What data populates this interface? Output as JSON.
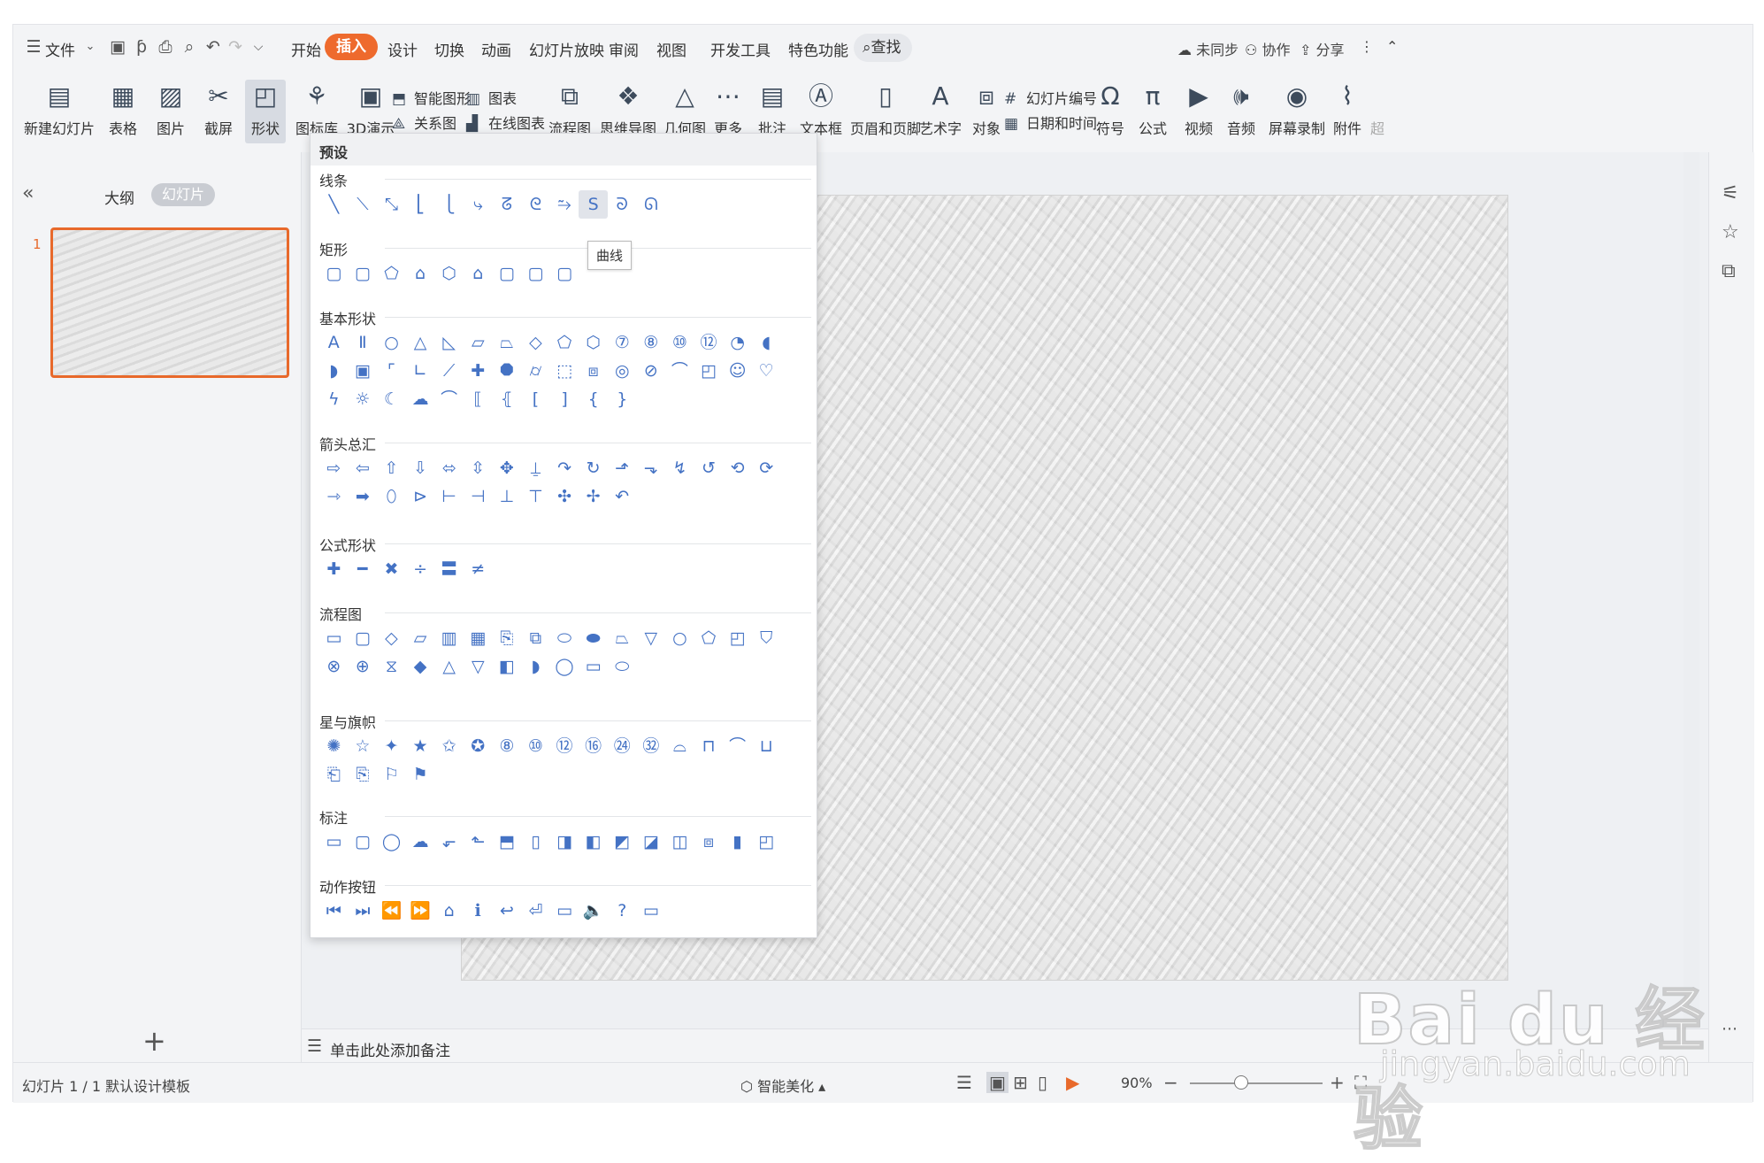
{
  "menu": {
    "file": "文件",
    "tabs": [
      "开始",
      "插入",
      "设计",
      "切换",
      "动画",
      "幻灯片放映",
      "审阅",
      "视图",
      "开发工具",
      "特色功能"
    ],
    "active_tab": "插入",
    "search": "查找",
    "sync": "未同步",
    "collab": "协作",
    "share": "分享"
  },
  "ribbon": {
    "new_slide": "新建幻灯片",
    "table": "表格",
    "picture": "图片",
    "screenshot": "截屏",
    "shape": "形状",
    "icon_lib": "图标库",
    "demo3d": "3D演示",
    "smart_graphic": "智能图形",
    "chart": "图表",
    "relation": "关系图",
    "online_chart": "在线图表",
    "flowchart": "流程图",
    "mindmap": "思维导图",
    "geometry": "几何图",
    "more": "更多",
    "comment": "批注",
    "textbox": "文本框",
    "header_footer": "页眉和页脚",
    "wordart": "艺术字",
    "object": "对象",
    "slide_number": "幻灯片编号",
    "datetime": "日期和时间",
    "symbol": "符号",
    "formula": "公式",
    "video": "视频",
    "audio": "音频",
    "screen_record": "屏幕录制",
    "attachment": "附件",
    "hyperlink_partial": "超"
  },
  "left_pane": {
    "outline_tab": "大纲",
    "slides_tab": "幻灯片",
    "slide_number": "1"
  },
  "notes_placeholder": "单击此处添加备注",
  "status": {
    "slide_count": "幻灯片 1 / 1",
    "template": "默认设计模板",
    "beautify": "智能美化",
    "zoom": "90%"
  },
  "dropdown": {
    "header": "预设",
    "sections": [
      {
        "title": "线条",
        "shapes": [
          "╲",
          "⟍",
          "⤡",
          "⎣",
          "⎩",
          "⤷",
          "ᘔ",
          "ᘓ",
          "⥲",
          "S",
          "ᘐ",
          "ᘏ"
        ]
      },
      {
        "title": "矩形",
        "shapes": [
          "▢",
          "▢",
          "⬠",
          "⌂",
          "⬡",
          "⌂",
          "▢",
          "▢",
          "▢"
        ]
      },
      {
        "title": "基本形状",
        "shapes": [
          "A",
          "Ⅱ",
          "○",
          "△",
          "◺",
          "▱",
          "⏢",
          "◇",
          "⬠",
          "⬡",
          "⑦",
          "⑧",
          "⑩",
          "⑫",
          "◔",
          "◖",
          "◗",
          "▣",
          "⌜",
          "∟",
          "⟋",
          "✚",
          "⯃",
          "⌭",
          "⬚",
          "⧈",
          "◎",
          "⊘",
          "⌒",
          "◰",
          "☺",
          "♡",
          "ϟ",
          "☼",
          "☾",
          "☁",
          "⌒",
          "⟦",
          "⦃",
          "[",
          "]",
          "{",
          "}"
        ]
      },
      {
        "title": "箭头总汇",
        "shapes": [
          "⇨",
          "⇦",
          "⇧",
          "⇩",
          "⬄",
          "⇳",
          "✥",
          "⍊",
          "↷",
          "↻",
          "⬏",
          "⬎",
          "↯",
          "↺",
          "⟲",
          "⟳",
          "⇾",
          "➡",
          "⬯",
          "⊳",
          "⊢",
          "⊣",
          "⊥",
          "⊤",
          "✣",
          "✢",
          "↶"
        ]
      },
      {
        "title": "公式形状",
        "shapes": [
          "✚",
          "━",
          "✖",
          "÷",
          "〓",
          "≠"
        ]
      },
      {
        "title": "流程图",
        "shapes": [
          "▭",
          "▢",
          "◇",
          "▱",
          "▥",
          "▦",
          "⎘",
          "⧉",
          "⬭",
          "⬬",
          "⏢",
          "▽",
          "○",
          "⬠",
          "◰",
          "⛉",
          "⊗",
          "⊕",
          "⧖",
          "◆",
          "△",
          "▽",
          "◧",
          "◗",
          "◯",
          "▭",
          "⬭"
        ]
      },
      {
        "title": "星与旗帜",
        "shapes": [
          "✺",
          "☆",
          "✦",
          "★",
          "✩",
          "✪",
          "⑧",
          "⑩",
          "⑫",
          "⑯",
          "㉔",
          "㉜",
          "⌓",
          "⊓",
          "⌒",
          "⊔",
          "⎗",
          "⎘",
          "⚐",
          "⚑"
        ]
      },
      {
        "title": "标注",
        "shapes": [
          "▭",
          "▢",
          "◯",
          "☁",
          "⬐",
          "⬑",
          "⬒",
          "▯",
          "◨",
          "◧",
          "◩",
          "◪",
          "◫",
          "⧈",
          "▮",
          "◰"
        ]
      },
      {
        "title": "动作按钮",
        "shapes": [
          "⏮",
          "⏭",
          "⏪",
          "⏩",
          "⌂",
          "ℹ",
          "↩",
          "⏎",
          "▭",
          "🔈",
          "?",
          "▭"
        ]
      }
    ],
    "tooltip": "曲线"
  },
  "watermark": {
    "main": "Bai du 经验",
    "sub": "jingyan.baidu.com"
  }
}
